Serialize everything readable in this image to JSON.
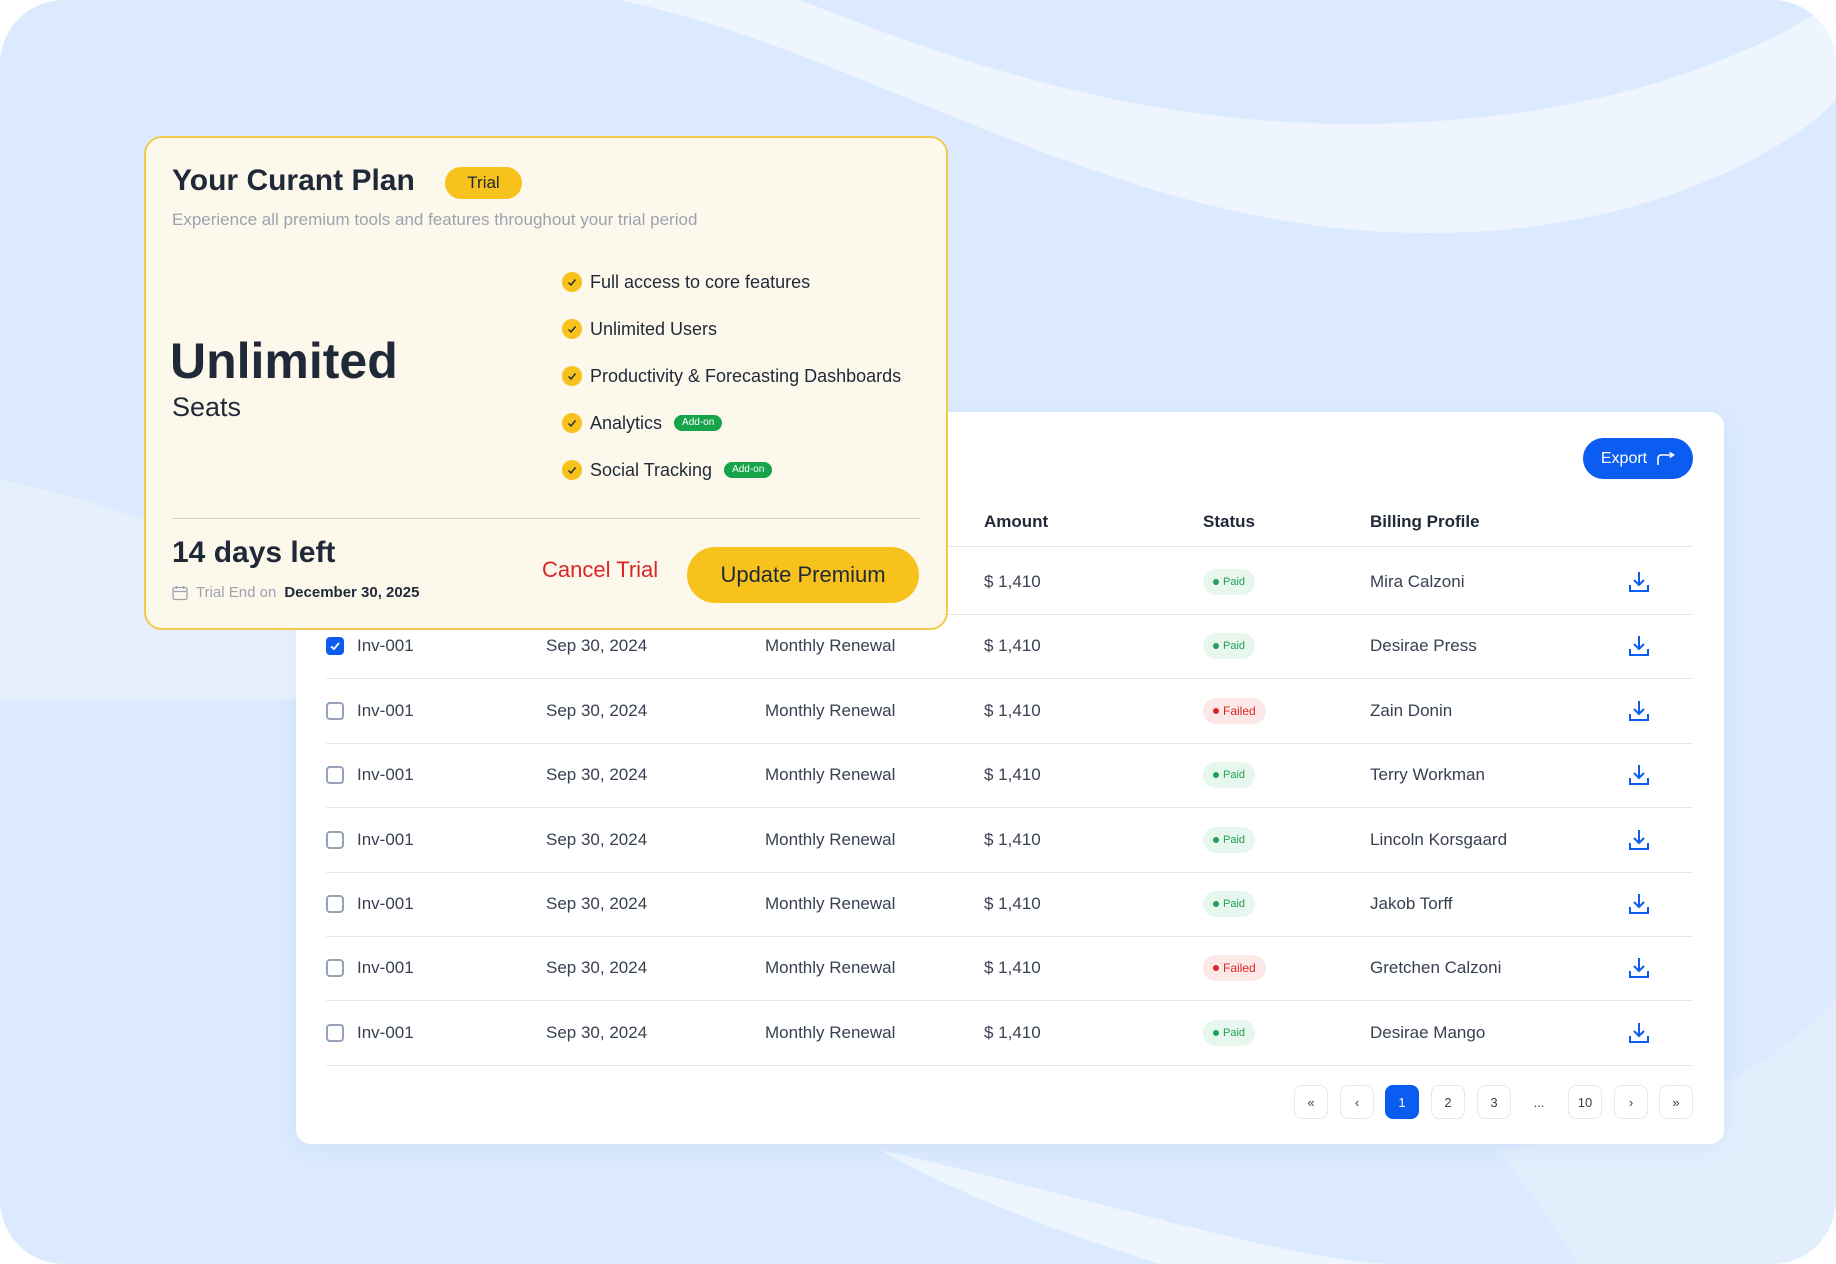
{
  "plan": {
    "title": "Your Curant Plan",
    "badge": "Trial",
    "subtitle": "Experience all premium tools and features throughout your trial period",
    "big_value": "Unlimited",
    "big_label": "Seats",
    "features": [
      {
        "label": "Full access to core features",
        "addon": ""
      },
      {
        "label": "Unlimited Users",
        "addon": ""
      },
      {
        "label": "Productivity & Forecasting Dashboards",
        "addon": ""
      },
      {
        "label": "Analytics",
        "addon": "Add-on"
      },
      {
        "label": "Social Tracking",
        "addon": "Add-on"
      }
    ],
    "days_left": "14 days left",
    "trial_end_label": "Trial End on",
    "trial_end_date": "December 30, 2025",
    "cancel_label": "Cancel Trial",
    "update_label": "Update Premium"
  },
  "table": {
    "export_label": "Export",
    "columns": {
      "amount": "Amount",
      "status": "Status",
      "billing": "Billing Profile"
    },
    "rows": [
      {
        "invoice": "",
        "date": "",
        "type": "",
        "amount": "$ 1,410",
        "status": "Paid",
        "profile": "Mira Calzoni",
        "checked": false,
        "hidden_by_card": true
      },
      {
        "invoice": "Inv-001",
        "date": "Sep 30, 2024",
        "type": "Monthly Renewal",
        "amount": "$ 1,410",
        "status": "Paid",
        "profile": "Desirae Press",
        "checked": true
      },
      {
        "invoice": "Inv-001",
        "date": "Sep 30, 2024",
        "type": "Monthly Renewal",
        "amount": "$ 1,410",
        "status": "Failed",
        "profile": "Zain Donin",
        "checked": false
      },
      {
        "invoice": "Inv-001",
        "date": "Sep 30, 2024",
        "type": "Monthly Renewal",
        "amount": "$ 1,410",
        "status": "Paid",
        "profile": "Terry Workman",
        "checked": false
      },
      {
        "invoice": "Inv-001",
        "date": "Sep 30, 2024",
        "type": "Monthly Renewal",
        "amount": "$ 1,410",
        "status": "Paid",
        "profile": "Lincoln Korsgaard",
        "checked": false
      },
      {
        "invoice": "Inv-001",
        "date": "Sep 30, 2024",
        "type": "Monthly Renewal",
        "amount": "$ 1,410",
        "status": "Paid",
        "profile": "Jakob Torff",
        "checked": false
      },
      {
        "invoice": "Inv-001",
        "date": "Sep 30, 2024",
        "type": "Monthly Renewal",
        "amount": "$ 1,410",
        "status": "Failed",
        "profile": "Gretchen Calzoni",
        "checked": false
      },
      {
        "invoice": "Inv-001",
        "date": "Sep 30, 2024",
        "type": "Monthly Renewal",
        "amount": "$ 1,410",
        "status": "Paid",
        "profile": "Desirae Mango",
        "checked": false
      }
    ]
  },
  "pagination": {
    "first": "«",
    "prev": "‹",
    "pages": [
      "1",
      "2",
      "3"
    ],
    "ellipsis": "...",
    "last_page": "10",
    "next": "›",
    "last": "»",
    "current": "1"
  },
  "colors": {
    "accent": "#0b5cf0",
    "yellow": "#f7c21b",
    "paid": "#22a05a",
    "failed": "#dc2626",
    "background": "#dbeafe"
  },
  "icons": {
    "export": "export-arrow-icon",
    "download": "download-icon",
    "calendar": "calendar-icon",
    "check": "check-icon"
  }
}
